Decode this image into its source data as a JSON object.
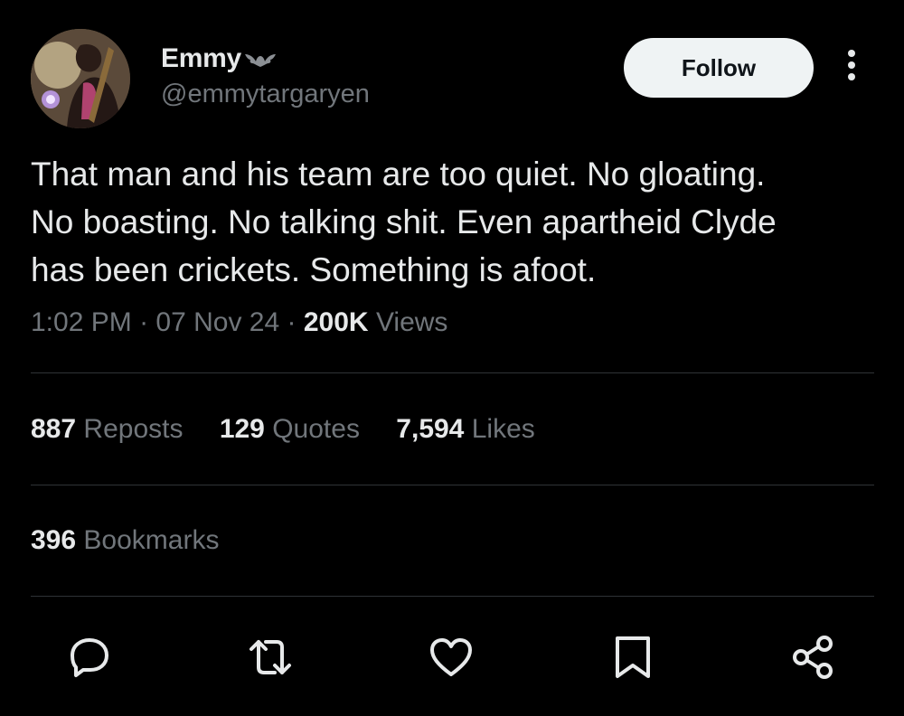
{
  "author": {
    "display_name": "Emmy",
    "handle": "@emmytargaryen",
    "name_emoji_icon": "bat-icon",
    "avatar_icon": "avatar-image"
  },
  "header": {
    "follow_label": "Follow",
    "more_icon": "more-options-icon"
  },
  "tweet": {
    "lines": [
      "That man and his team are too quiet. No gloating.",
      "No boasting. No talking shit. Even apartheid Clyde",
      "has been crickets. Something is afoot."
    ],
    "time": "1:02 PM",
    "separator": "·",
    "date": "07 Nov 24",
    "views_count": "200K",
    "views_label": "Views"
  },
  "stats": {
    "reposts_count": "887",
    "reposts_label": "Reposts",
    "quotes_count": "129",
    "quotes_label": "Quotes",
    "likes_count": "7,594",
    "likes_label": "Likes",
    "bookmarks_count": "396",
    "bookmarks_label": "Bookmarks"
  },
  "actions": [
    "reply-icon",
    "repost-icon",
    "like-icon",
    "bookmark-icon",
    "share-icon"
  ],
  "colors": {
    "background": "#000000",
    "primary_text": "#e7e9ea",
    "secondary_text": "#71767b",
    "divider": "#2f3336",
    "follow_button_bg": "#eff3f4"
  }
}
